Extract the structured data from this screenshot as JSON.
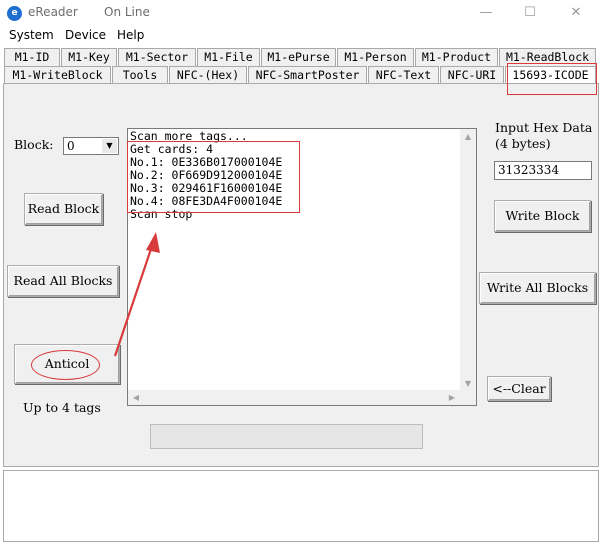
{
  "window": {
    "icon_letter": "e",
    "title": "eReader",
    "status": "On Line",
    "minimize_glyph": "—",
    "maximize_glyph": "☐",
    "close_glyph": "✕"
  },
  "menu": {
    "items": [
      "System",
      "Device",
      "Help"
    ]
  },
  "tabs": {
    "row1": [
      "M1-ID",
      "M1-Key",
      "M1-Sector",
      "M1-File",
      "M1-ePurse",
      "M1-Person",
      "M1-Product",
      "M1-ReadBlock"
    ],
    "row2": [
      "M1-WriteBlock",
      "Tools",
      "NFC-(Hex)",
      "NFC-SmartPoster",
      "NFC-Text",
      "NFC-URI",
      "15693-ICODE"
    ],
    "active": "15693-ICODE"
  },
  "left": {
    "block_label": "Block:",
    "block_value": "0",
    "read_block": "Read Block",
    "read_all_blocks": "Read All Blocks",
    "anticol": "Anticol",
    "up_to_tags": "Up to 4 tags"
  },
  "log": {
    "lines": [
      "Scan more tags...",
      "Get cards: 4",
      "No.1: 0E336B017000104E",
      "No.2: 0F669D912000104E",
      "No.3: 029461F16000104E",
      "No.4: 08FE3DA4F000104E",
      "Scan stop"
    ]
  },
  "right": {
    "input_hex_label_1": "Input Hex Data",
    "input_hex_label_2": "(4 bytes)",
    "hex_value": "31323334",
    "write_block": "Write Block",
    "write_all_blocks": "Write All Blocks",
    "clear": "<--Clear"
  },
  "colors": {
    "annotation": "#d83b3b",
    "panel": "#f0f0f0"
  }
}
